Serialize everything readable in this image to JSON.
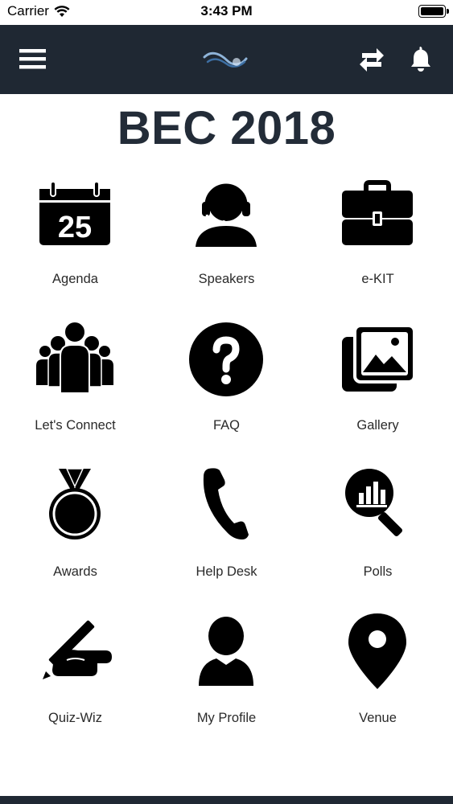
{
  "status_bar": {
    "carrier": "Carrier",
    "time": "3:43 PM"
  },
  "header": {
    "background": "#1f2833",
    "icons": [
      "menu-icon",
      "logo",
      "sync-icon",
      "bell-icon"
    ]
  },
  "page": {
    "title": "BEC 2018"
  },
  "tiles": [
    {
      "label": "Agenda",
      "icon": "calendar-icon",
      "calendar_day": "25"
    },
    {
      "label": "Speakers",
      "icon": "headset-user-icon"
    },
    {
      "label": "e-KIT",
      "icon": "briefcase-icon"
    },
    {
      "label": "Let's Connect",
      "icon": "group-icon"
    },
    {
      "label": "FAQ",
      "icon": "question-icon"
    },
    {
      "label": "Gallery",
      "icon": "gallery-icon"
    },
    {
      "label": "Awards",
      "icon": "medal-icon"
    },
    {
      "label": "Help Desk",
      "icon": "phone-icon"
    },
    {
      "label": "Polls",
      "icon": "poll-search-icon"
    },
    {
      "label": "Quiz-Wiz",
      "icon": "pencil-hand-icon"
    },
    {
      "label": "My Profile",
      "icon": "profile-icon"
    },
    {
      "label": "Venue",
      "icon": "location-pin-icon"
    }
  ]
}
